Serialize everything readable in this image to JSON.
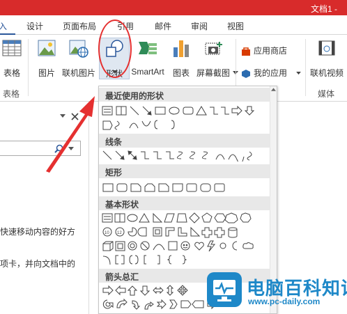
{
  "titlebar": {
    "doc_title": "文档1 -",
    "color": "#d82b2b"
  },
  "tabs": [
    "入",
    "设计",
    "页面布局",
    "引用",
    "邮件",
    "审阅",
    "视图"
  ],
  "ribbon": {
    "table_label": "表格",
    "table_group": "表格",
    "picture_label": "图片",
    "online_picture_label": "联机图片",
    "shapes_label": "形状",
    "smartart_label": "SmartArt",
    "chart_label": "图表",
    "screenshot_label": "屏幕截图",
    "app_store_label": "应用商店",
    "my_apps_label": "我的应用",
    "online_video_label": "联机视频",
    "media_group": "媒体"
  },
  "leftpane": {
    "line1": "快速移动内容的好方",
    "line2": "项卡，并向文档中的"
  },
  "shapes_panel": {
    "recent": "最近使用的形状",
    "lines": "线条",
    "rectangles": "矩形",
    "basic": "基本形状",
    "arrows": "箭头总汇"
  },
  "watermark": {
    "name": "电脑百科知识",
    "url": "www.pc-daily.com"
  },
  "colors": {
    "accent": "#2b579a",
    "annotation": "#e53030",
    "watermark": "#1e88c8"
  }
}
